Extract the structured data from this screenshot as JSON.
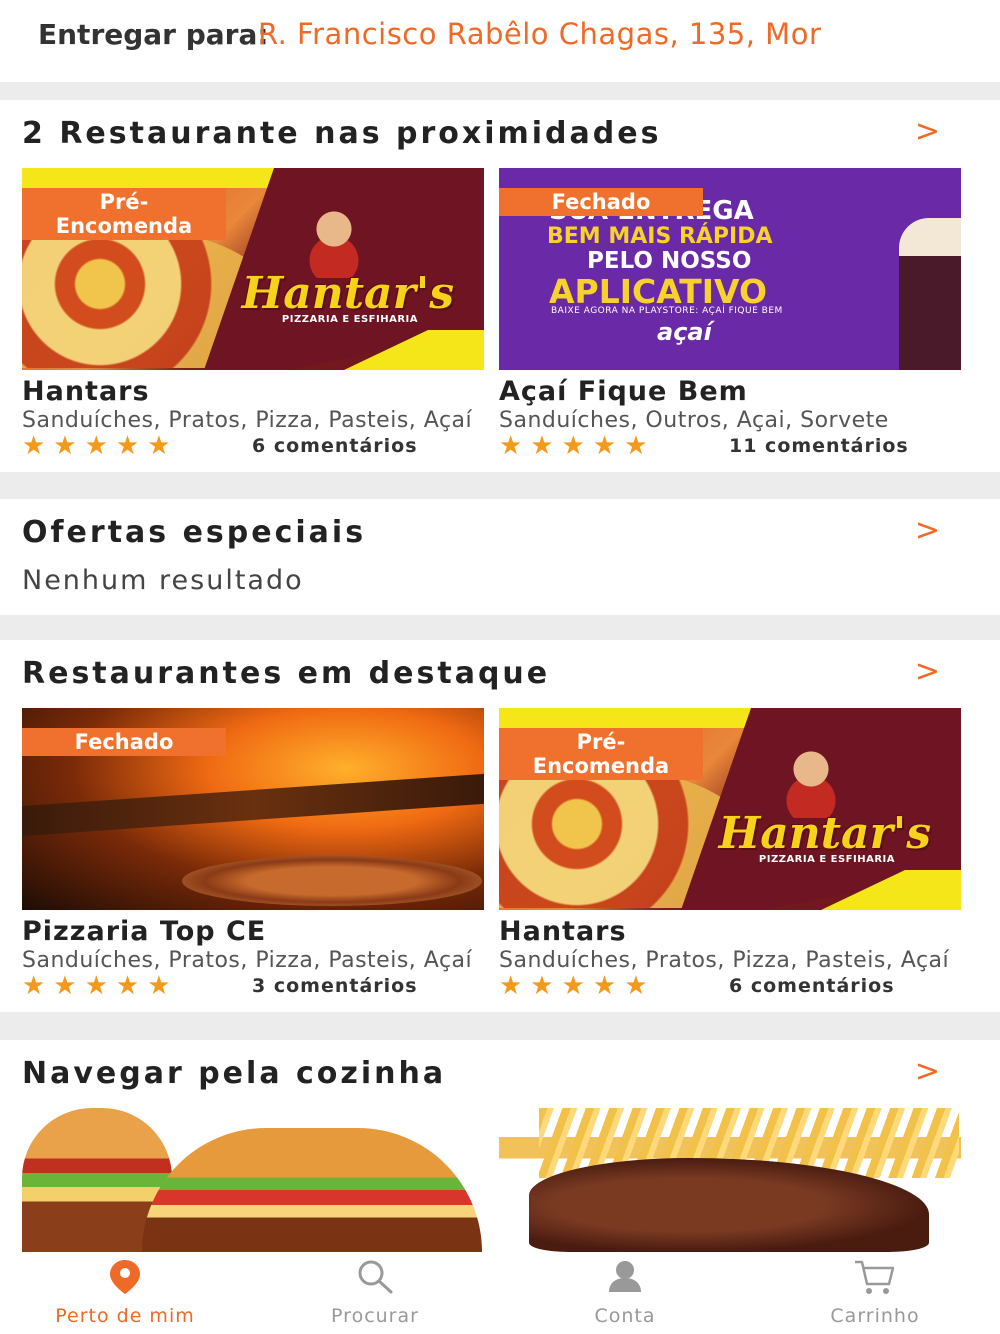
{
  "header": {
    "deliver_label": "Entregar para:",
    "address": "R. Francisco Rabêlo Chagas, 135, Mor"
  },
  "nearby": {
    "title": "2 Restaurante nas proximidades",
    "chevron": ">",
    "cards": [
      {
        "badge": "Pré-\nEncomenda",
        "logo_text": "Hantar's",
        "logo_sub": "PIZZARIA E ESFIHARIA",
        "name": "Hantars",
        "categories": "Sanduíches, Pratos, Pizza, Pasteis, Açaí",
        "stars": "★★★★★",
        "rating": 5,
        "reviews": "6 comentários"
      },
      {
        "badge": "Fechado",
        "promo": [
          "SUA ENTREGA",
          "BEM MAIS RÁPIDA",
          "PELO NOSSO",
          "APLICATIVO",
          "BAIXE AGORA NA PLAYSTORE: AÇAÍ FIQUE BEM",
          "açaí"
        ],
        "name": "Açaí Fique Bem",
        "categories": "Sanduíches, Outros, Açai, Sorvete",
        "stars": "★★★★★",
        "rating": 4.5,
        "reviews": "11 comentários"
      }
    ]
  },
  "offers": {
    "title": "Ofertas especiais",
    "chevron": ">",
    "empty": "Nenhum resultado"
  },
  "featured": {
    "title": "Restaurantes em destaque",
    "chevron": ">",
    "cards": [
      {
        "badge": "Fechado",
        "name": "Pizzaria Top CE",
        "categories": "Sanduíches, Pratos, Pizza, Pasteis, Açaí",
        "stars": "★★★★★",
        "rating": 5,
        "reviews": "3 comentários"
      },
      {
        "badge": "Pré-\nEncomenda",
        "logo_text": "Hantar's",
        "logo_sub": "PIZZARIA E ESFIHARIA",
        "name": "Hantars",
        "categories": "Sanduíches, Pratos, Pizza, Pasteis, Açaí",
        "stars": "★★★★★",
        "rating": 5,
        "reviews": "6 comentários"
      }
    ]
  },
  "cuisine": {
    "title": "Navegar pela cozinha",
    "chevron": ">"
  },
  "tabs": [
    {
      "label": "Perto de mim",
      "icon": "location-pin-icon",
      "active": true
    },
    {
      "label": "Procurar",
      "icon": "search-icon",
      "active": false
    },
    {
      "label": "Conta",
      "icon": "account-icon",
      "active": false
    },
    {
      "label": "Carrinho",
      "icon": "cart-icon",
      "active": false
    }
  ],
  "colors": {
    "accent": "#ee6a26",
    "badge": "#f0702d",
    "star": "#f39a1c"
  }
}
